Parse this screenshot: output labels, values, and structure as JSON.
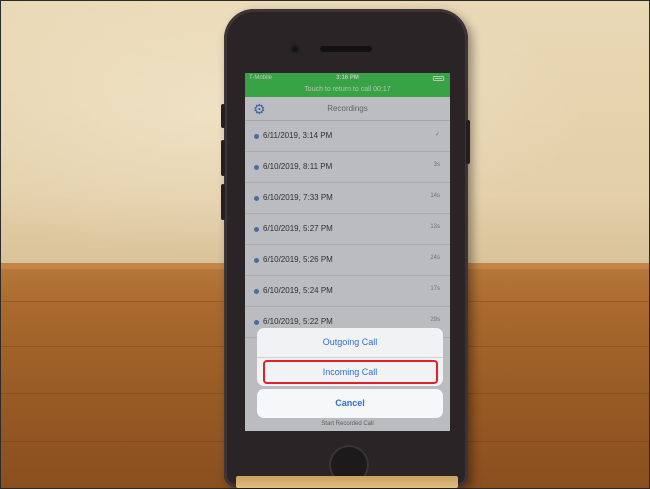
{
  "status_bar": {
    "carrier": "T-Mobile",
    "time": "3:16 PM",
    "return_banner": "Touch to return to call 00:17"
  },
  "nav": {
    "title": "Recordings",
    "settings_icon": "gear-icon"
  },
  "recordings": [
    {
      "date": "6/11/2019, 3:14 PM",
      "duration": "✓"
    },
    {
      "date": "6/10/2019, 8:11 PM",
      "duration": "3s"
    },
    {
      "date": "6/10/2019, 7:33 PM",
      "duration": "14s"
    },
    {
      "date": "6/10/2019, 5:27 PM",
      "duration": "13s"
    },
    {
      "date": "6/10/2019, 5:26 PM",
      "duration": "24s"
    },
    {
      "date": "6/10/2019, 5:24 PM",
      "duration": "17s"
    },
    {
      "date": "6/10/2019, 5:22 PM",
      "duration": "29s"
    }
  ],
  "action_sheet": {
    "outgoing_label": "Outgoing Call",
    "incoming_label": "Incoming Call",
    "cancel_label": "Cancel"
  },
  "behind_sheet_text": "Start Recorded Call",
  "colors": {
    "status_green": "#3fd24c",
    "accent_blue": "#2c6fd6",
    "highlight_red": "#e0202c"
  }
}
